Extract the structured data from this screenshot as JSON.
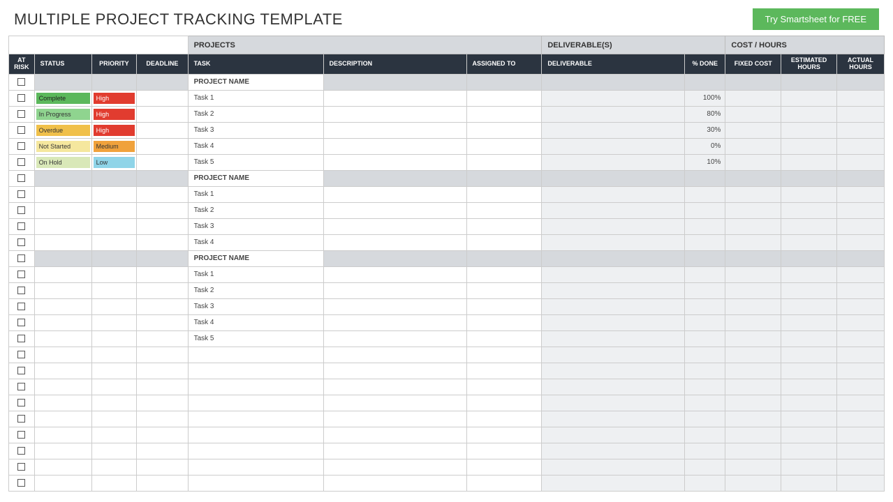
{
  "header": {
    "title": "MULTIPLE PROJECT TRACKING TEMPLATE",
    "cta": "Try Smartsheet for FREE"
  },
  "sections": {
    "projects": "PROJECTS",
    "deliverables": "DELIVERABLE(S)",
    "costhours": "COST / HOURS"
  },
  "columns": {
    "atrisk": "AT RISK",
    "status": "STATUS",
    "priority": "PRIORITY",
    "deadline": "DEADLINE",
    "task": "TASK",
    "description": "DESCRIPTION",
    "assigned": "ASSIGNED TO",
    "deliverable": "DELIVERABLE",
    "pctdone": "% DONE",
    "fixedcost": "FIXED COST",
    "esthours": "ESTIMATED HOURS",
    "acthours": "ACTUAL HOURS"
  },
  "statusLabels": {
    "complete": "Complete",
    "inprogress": "In Progress",
    "overdue": "Overdue",
    "notstarted": "Not Started",
    "onhold": "On Hold"
  },
  "priorityLabels": {
    "high": "High",
    "medium": "Medium",
    "low": "Low"
  },
  "projects": [
    {
      "name": "PROJECT NAME",
      "tasks": [
        {
          "task": "Task 1",
          "status": "complete",
          "priority": "high",
          "pct": "100%"
        },
        {
          "task": "Task 2",
          "status": "inprogress",
          "priority": "high",
          "pct": "80%"
        },
        {
          "task": "Task 3",
          "status": "overdue",
          "priority": "high",
          "pct": "30%"
        },
        {
          "task": "Task 4",
          "status": "notstarted",
          "priority": "medium",
          "pct": "0%"
        },
        {
          "task": "Task 5",
          "status": "onhold",
          "priority": "low",
          "pct": "10%"
        }
      ]
    },
    {
      "name": "PROJECT NAME",
      "tasks": [
        {
          "task": "Task 1"
        },
        {
          "task": "Task 2"
        },
        {
          "task": "Task 3"
        },
        {
          "task": "Task 4"
        }
      ]
    },
    {
      "name": "PROJECT NAME",
      "tasks": [
        {
          "task": "Task 1"
        },
        {
          "task": "Task 2"
        },
        {
          "task": "Task 3"
        },
        {
          "task": "Task 4"
        },
        {
          "task": "Task 5"
        }
      ]
    }
  ],
  "emptyRows": 9
}
